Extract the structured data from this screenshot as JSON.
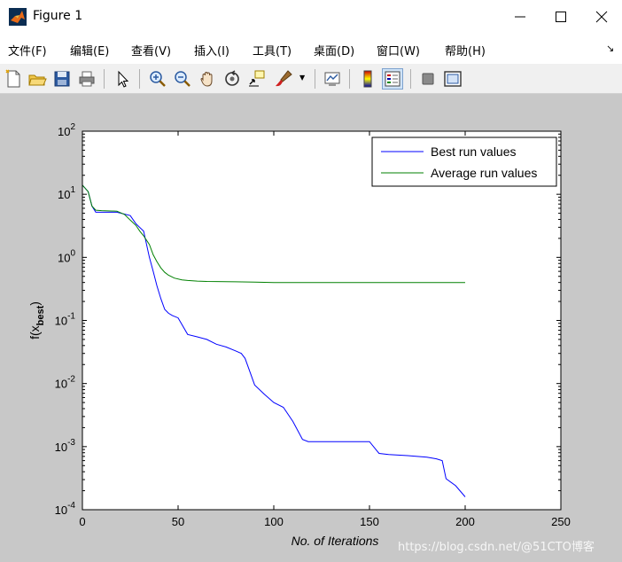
{
  "window": {
    "title": "Figure 1"
  },
  "menu": [
    {
      "label": "文件(F)"
    },
    {
      "label": "编辑(E)"
    },
    {
      "label": "查看(V)"
    },
    {
      "label": "插入(I)"
    },
    {
      "label": "工具(T)"
    },
    {
      "label": "桌面(D)"
    },
    {
      "label": "窗口(W)"
    },
    {
      "label": "帮助(H)"
    }
  ],
  "toolbar": [
    "new-figure-icon",
    "open-file-icon",
    "save-icon",
    "print-icon",
    "pointer-icon",
    "zoom-in-icon",
    "zoom-out-icon",
    "pan-hand-icon",
    "rotate-3d-icon",
    "data-cursor-icon",
    "brush-icon",
    "link-plot-icon",
    "colorbar-icon",
    "legend-icon",
    "hide-plot-tools-icon",
    "show-plot-tools-icon"
  ],
  "chart_data": {
    "type": "line",
    "xlabel": "No. of Iterations",
    "ylabel": "f(x_best)",
    "ylabel_main": "f(x",
    "ylabel_sub": "best",
    "ylabel_close": ")",
    "xlim": [
      0,
      250
    ],
    "ylim": [
      0.0001,
      100
    ],
    "yscale": "log",
    "x_ticks": [
      "0",
      "50",
      "100",
      "150",
      "200",
      "250"
    ],
    "y_ticks": [
      {
        "base": "10",
        "exp": "-4"
      },
      {
        "base": "10",
        "exp": "-3"
      },
      {
        "base": "10",
        "exp": "-2"
      },
      {
        "base": "10",
        "exp": "-1"
      },
      {
        "base": "10",
        "exp": "0"
      },
      {
        "base": "10",
        "exp": "1"
      },
      {
        "base": "10",
        "exp": "2"
      }
    ],
    "legend_position": "top-right",
    "series": [
      {
        "name": "Best run values",
        "color": "#0000ff",
        "x": [
          0,
          3,
          5,
          7,
          10,
          18,
          25,
          28,
          32,
          35,
          37,
          39,
          41,
          43,
          45,
          47,
          50,
          55,
          60,
          65,
          70,
          75,
          80,
          83,
          85,
          88,
          90,
          95,
          100,
          105,
          110,
          115,
          118,
          120,
          130,
          140,
          150,
          155,
          160,
          170,
          180,
          185,
          188,
          190,
          195,
          200
        ],
        "y": [
          14,
          11,
          6.5,
          5.2,
          5.2,
          5.2,
          4.6,
          3.4,
          2.6,
          1.0,
          0.6,
          0.35,
          0.22,
          0.15,
          0.13,
          0.12,
          0.11,
          0.06,
          0.055,
          0.05,
          0.042,
          0.038,
          0.033,
          0.03,
          0.025,
          0.014,
          0.0095,
          0.0068,
          0.005,
          0.0042,
          0.0025,
          0.0013,
          0.0012,
          0.0012,
          0.0012,
          0.0012,
          0.0012,
          0.00078,
          0.00075,
          0.00072,
          0.00068,
          0.00064,
          0.0006,
          0.00031,
          0.00024,
          0.00016
        ]
      },
      {
        "name": "Average run values",
        "color": "#008000",
        "x": [
          0,
          3,
          5,
          7,
          10,
          18,
          22,
          25,
          28,
          30,
          32,
          35,
          37,
          39,
          41,
          43,
          45,
          48,
          52,
          55,
          60,
          65,
          80,
          90,
          100,
          150,
          200
        ],
        "y": [
          14,
          11,
          6.5,
          5.6,
          5.5,
          5.4,
          4.8,
          3.9,
          3.2,
          2.6,
          2.2,
          1.6,
          1.1,
          0.85,
          0.68,
          0.58,
          0.52,
          0.47,
          0.44,
          0.43,
          0.42,
          0.415,
          0.41,
          0.405,
          0.4,
          0.4,
          0.4
        ]
      }
    ]
  },
  "watermark": "https://blog.csdn.net/@51CTO博客"
}
